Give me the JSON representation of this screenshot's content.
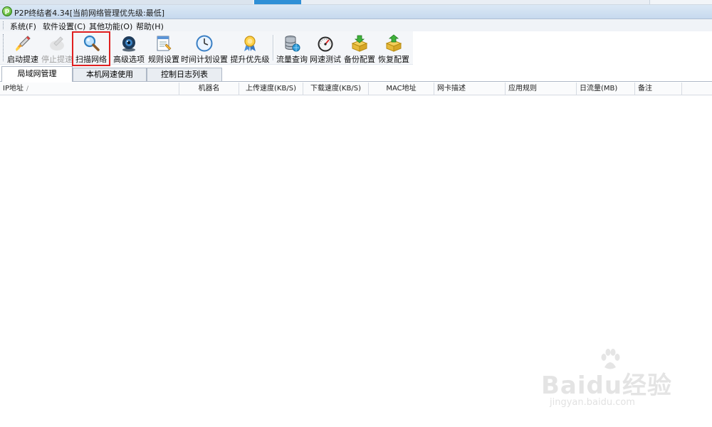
{
  "window": {
    "title": "P2P终结者4.34[当前网络管理优先级:最低]"
  },
  "menu": [
    {
      "label": "系统(F)"
    },
    {
      "label": "软件设置(C)"
    },
    {
      "label": "其他功能(O)"
    },
    {
      "label": "帮助(H)"
    }
  ],
  "toolbar": [
    {
      "label": "启动提速",
      "icon": "rocket-icon",
      "enabled": true
    },
    {
      "label": "停止提速",
      "icon": "stop-rocket-icon",
      "enabled": false
    },
    {
      "label": "扫描网络",
      "icon": "magnifier-icon",
      "enabled": true,
      "highlighted": true
    },
    {
      "label": "高级选项",
      "icon": "webcam-icon",
      "enabled": true
    },
    {
      "label": "规则设置",
      "icon": "rules-document-icon",
      "enabled": true
    },
    {
      "label": "时间计划设置",
      "icon": "clock-icon",
      "enabled": true
    },
    {
      "label": "提升优先级",
      "icon": "medal-icon",
      "enabled": true
    },
    {
      "label": "流量查询",
      "icon": "database-globe-icon",
      "enabled": true
    },
    {
      "label": "网速测试",
      "icon": "speedometer-icon",
      "enabled": true
    },
    {
      "label": "备份配置",
      "icon": "backup-box-icon",
      "enabled": true
    },
    {
      "label": "恢复配置",
      "icon": "restore-box-icon",
      "enabled": true
    }
  ],
  "tabs": [
    {
      "label": "局域网管理",
      "active": true
    },
    {
      "label": "本机网速使用",
      "active": false
    },
    {
      "label": "控制日志列表",
      "active": false
    }
  ],
  "columns": [
    {
      "label": "IP地址",
      "sort": "/"
    },
    {
      "label": "机器名"
    },
    {
      "label": "上传速度(KB/S)"
    },
    {
      "label": "下载速度(KB/S)"
    },
    {
      "label": "MAC地址"
    },
    {
      "label": "网卡描述"
    },
    {
      "label": "应用规则"
    },
    {
      "label": "日流量(MB)"
    },
    {
      "label": "备注"
    }
  ],
  "rows": [],
  "watermark": {
    "brand": "Baidu经验",
    "url": "jingyan.baidu.com"
  },
  "colors": {
    "highlight": "#e02020",
    "title_bar": "#c6d9ee"
  }
}
